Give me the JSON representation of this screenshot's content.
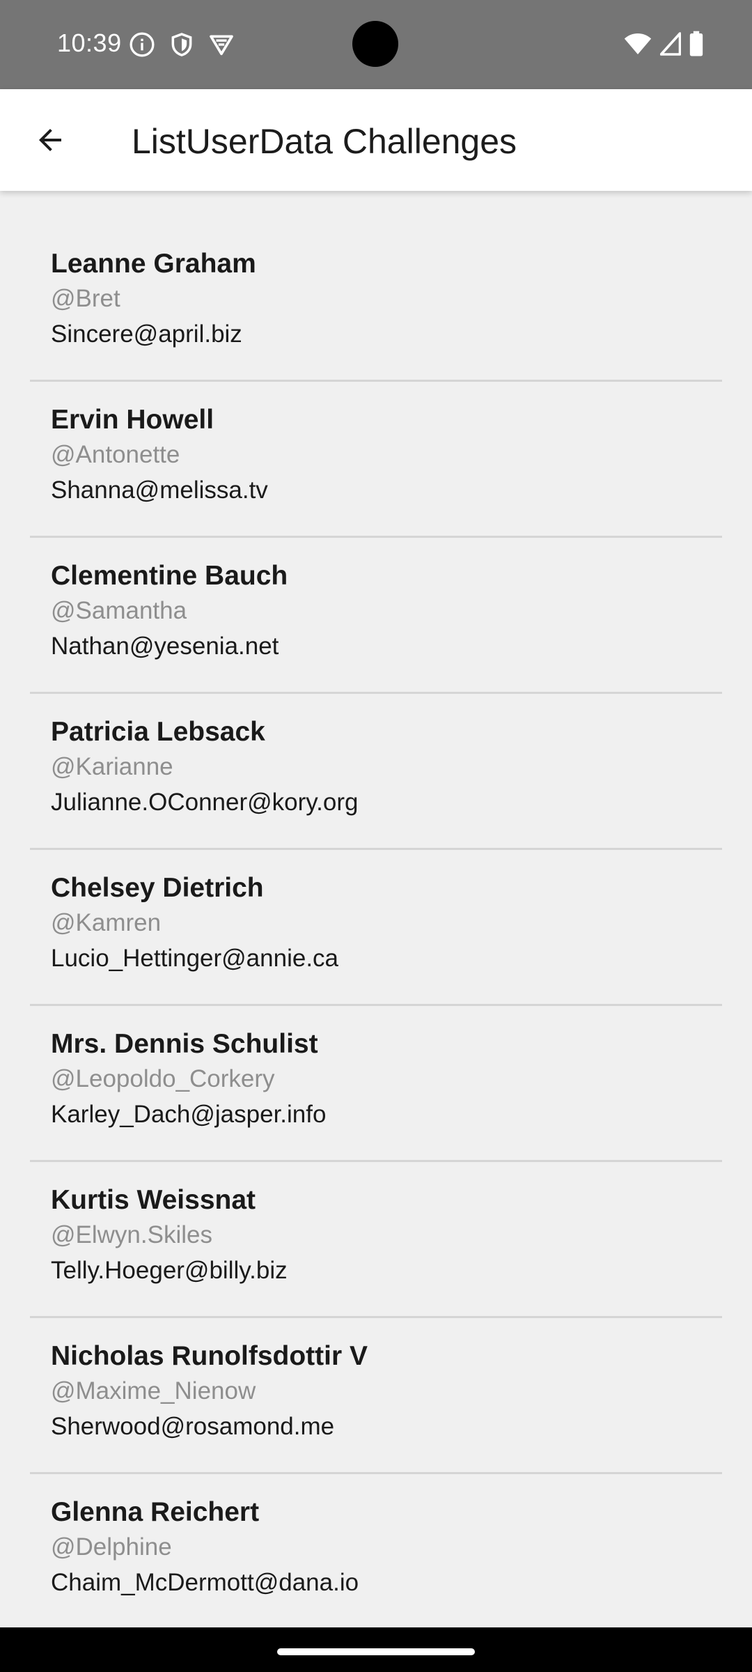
{
  "status_bar": {
    "time": "10:39",
    "left_icons": [
      "info-icon",
      "shield-icon",
      "vpn-icon"
    ],
    "right_icons": [
      "wifi-icon",
      "cellular-signal-icon",
      "battery-icon"
    ],
    "background": "#757575"
  },
  "app_bar": {
    "title": "ListUserData Challenges",
    "back_icon": "arrow-left-icon"
  },
  "users": [
    {
      "name": "Leanne Graham",
      "username": "@Bret",
      "email": "Sincere@april.biz"
    },
    {
      "name": "Ervin Howell",
      "username": "@Antonette",
      "email": "Shanna@melissa.tv"
    },
    {
      "name": "Clementine Bauch",
      "username": "@Samantha",
      "email": "Nathan@yesenia.net"
    },
    {
      "name": "Patricia Lebsack",
      "username": "@Karianne",
      "email": "Julianne.OConner@kory.org"
    },
    {
      "name": "Chelsey Dietrich",
      "username": "@Kamren",
      "email": "Lucio_Hettinger@annie.ca"
    },
    {
      "name": "Mrs. Dennis Schulist",
      "username": "@Leopoldo_Corkery",
      "email": "Karley_Dach@jasper.info"
    },
    {
      "name": "Kurtis Weissnat",
      "username": "@Elwyn.Skiles",
      "email": "Telly.Hoeger@billy.biz"
    },
    {
      "name": "Nicholas Runolfsdottir V",
      "username": "@Maxime_Nienow",
      "email": "Sherwood@rosamond.me"
    },
    {
      "name": "Glenna Reichert",
      "username": "@Delphine",
      "email": "Chaim_McDermott@dana.io"
    }
  ],
  "colors": {
    "page_background": "#f0f0f0",
    "divider": "#d5d5d5",
    "username_text": "#8e8e8e"
  }
}
